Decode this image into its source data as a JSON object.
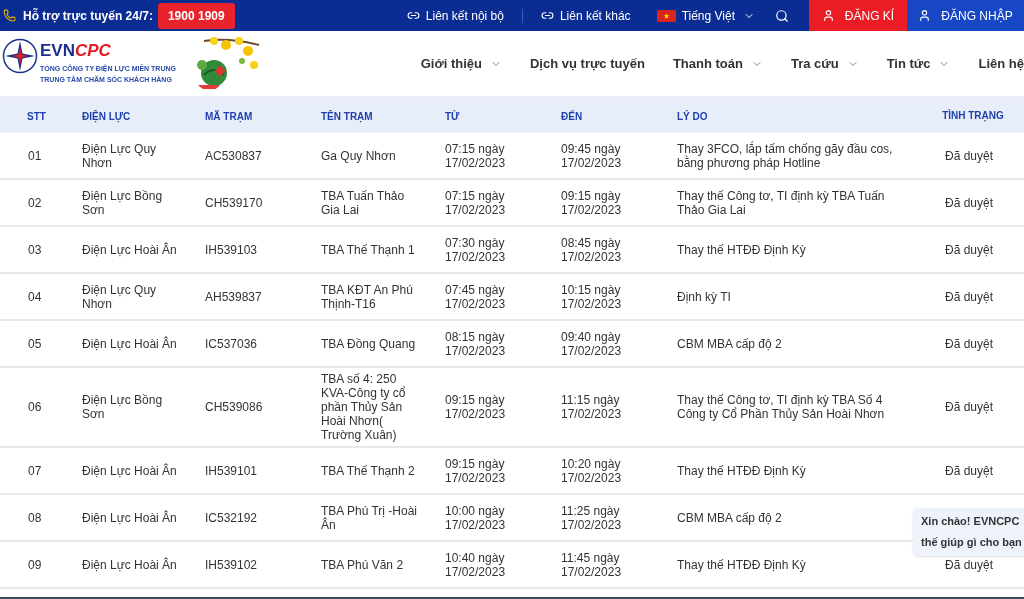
{
  "top_bar": {
    "support_label": "Hỗ trợ trực tuyến 24/7:",
    "hotline": "1900 1909",
    "links": [
      "Liên kết nội bộ",
      "Liên kết khác"
    ],
    "language": "Tiếng Việt",
    "register": "ĐĂNG KÍ",
    "login": "ĐĂNG NHẬP"
  },
  "header": {
    "logo_evn": "EVN",
    "logo_cpc": "CPC",
    "company": "TỔNG CÔNG TY ĐIỆN LỰC MIỀN TRUNG",
    "center": "TRUNG TÂM CHĂM SÓC KHÁCH HÀNG",
    "nav": [
      {
        "label": "Giới thiệu",
        "has_menu": true
      },
      {
        "label": "Dịch vụ trực tuyến",
        "has_menu": false
      },
      {
        "label": "Thanh toán",
        "has_menu": true
      },
      {
        "label": "Tra cứu",
        "has_menu": true
      },
      {
        "label": "Tin tức",
        "has_menu": true
      },
      {
        "label": "Liên hệ",
        "has_menu": false
      }
    ]
  },
  "table": {
    "columns": [
      "STT",
      "ĐIỆN LỰC",
      "MÃ TRẠM",
      "TÊN TRẠM",
      "TỪ",
      "ĐẾN",
      "LÝ DO",
      "TÌNH TRẠNG"
    ],
    "rows": [
      {
        "stt": "01",
        "unit": "Điện Lực Quy Nhơn",
        "code": "AC530837",
        "station": "Ga Quy Nhơn",
        "from": "07:15 ngày 17/02/2023",
        "to": "09:45 ngày 17/02/2023",
        "reason": "Thay 3FCO, lắp tấm chống gãy đầu cos, bằng phương pháp Hotline",
        "status": "Đã duyệt"
      },
      {
        "stt": "02",
        "unit": "Điện Lực Bồng Sơn",
        "code": "CH539170",
        "station": "TBA Tuấn Thảo Gia Lai",
        "from": "07:15 ngày 17/02/2023",
        "to": "09:15 ngày 17/02/2023",
        "reason": "Thay thế Công tơ, TI định kỳ TBA Tuấn Thảo Gia Lai",
        "status": "Đã duyệt"
      },
      {
        "stt": "03",
        "unit": "Điện Lực Hoài Ân",
        "code": "IH539103",
        "station": "TBA Thế Thạnh 1",
        "from": "07:30 ngày 17/02/2023",
        "to": "08:45 ngày 17/02/2023",
        "reason": "Thay thế HTĐĐ Định Kỳ",
        "status": "Đã duyệt"
      },
      {
        "stt": "04",
        "unit": "Điện Lực Quy Nhơn",
        "code": "AH539837",
        "station": "TBA KĐT An Phú Thịnh-T16",
        "from": "07:45 ngày 17/02/2023",
        "to": "10:15 ngày 17/02/2023",
        "reason": "Định kỳ TI",
        "status": "Đã duyệt"
      },
      {
        "stt": "05",
        "unit": "Điện Lực Hoài Ân",
        "code": "IC537036",
        "station": "TBA Đồng Quang",
        "from": "08:15 ngày 17/02/2023",
        "to": "09:40 ngày 17/02/2023",
        "reason": "CBM MBA cấp độ 2",
        "status": "Đã duyệt"
      },
      {
        "stt": "06",
        "unit": "Điện Lực Bồng Sơn",
        "code": "CH539086",
        "station": "TBA số 4: 250 KVA-Công ty cổ phần Thủy Sản Hoài Nhơn( Trường Xuân)",
        "from": "09:15 ngày 17/02/2023",
        "to": "11:15 ngày 17/02/2023",
        "reason": "Thay thế Công tơ, TI định kỳ TBA Số 4 Công ty Cổ Phần Thủy Sản Hoài Nhơn",
        "status": "Đã duyệt"
      },
      {
        "stt": "07",
        "unit": "Điện Lực Hoài Ân",
        "code": "IH539101",
        "station": "TBA Thế Thạnh 2",
        "from": "09:15 ngày 17/02/2023",
        "to": "10:20 ngày 17/02/2023",
        "reason": "Thay thế HTĐĐ Định Kỳ",
        "status": "Đã duyệt"
      },
      {
        "stt": "08",
        "unit": "Điện Lực Hoài Ân",
        "code": "IC532192",
        "station": "TBA Phú Trị -Hoài Ân",
        "from": "10:00 ngày 17/02/2023",
        "to": "11:25 ngày 17/02/2023",
        "reason": "CBM MBA cấp độ 2"
      },
      {
        "stt": "09",
        "unit": "Điện Lực Hoài Ân",
        "code": "IH539102",
        "station": "TBA Phú Văn 2",
        "from": "10:40 ngày 17/02/2023",
        "to": "11:45 ngày 17/02/2023",
        "reason": "Thay thế HTĐĐ Định Kỳ",
        "status": "Đã duyệt"
      }
    ]
  },
  "chat_bubble": {
    "lines": [
      "Xin chào! EVNCPC",
      "thế giúp gì cho bạn"
    ]
  }
}
